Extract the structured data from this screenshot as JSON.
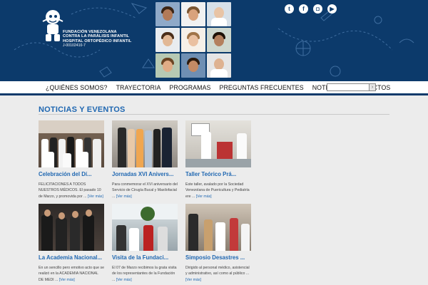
{
  "organization": {
    "lines": [
      "FUNDACIÓN VENEZOLANA",
      "CONTRA LA PARÁLISIS INFANTIL",
      "HOSPITAL ORTOPÉDICO INFANTIL"
    ],
    "rif": "J-00102410-7"
  },
  "social": [
    {
      "icon": "twitter-icon",
      "glyph": "t"
    },
    {
      "icon": "facebook-icon",
      "glyph": "f"
    },
    {
      "icon": "instagram-icon",
      "glyph": "◘"
    },
    {
      "icon": "youtube-icon",
      "glyph": "▶"
    }
  ],
  "nav": {
    "items": [
      "¿QUIÉNES SOMOS?",
      "TRAYECTORIA",
      "PROGRAMAS",
      "PREGUNTAS FRECUENTES",
      "NOTICIAS",
      "CONTACTOS"
    ],
    "search_placeholder": ""
  },
  "section": {
    "title": "NOTICIAS Y EVENTOS"
  },
  "news": [
    {
      "title": "Celebración del Dí...",
      "excerpt": "FELICITACIONES A TODOS NUESTROS MÉDICOS. El pasado 10 de Marzo, y promovida por ...",
      "more": "[Ver más]"
    },
    {
      "title": "Jornadas XVI Anivers...",
      "excerpt": "Para conmemorar el XVI aniversario del Servicio de Cirugía Bucal y Maxilofacial ...",
      "more": "[Ver más]"
    },
    {
      "title": "Taller Teórico Prá...",
      "excerpt": "Este taller, avalado por la Sociedad Venezolana de Puericultura y Pediatría ere ...",
      "more": "[Ver más]"
    },
    {
      "title": "La Academia Nacional...",
      "excerpt": "En un sencillo pero emotivo acto que se realizó en la ACADEMIA NACIONAL DE MEDI ...",
      "more": "[Ver más]"
    },
    {
      "title": "Visita de la Fundaci...",
      "excerpt": "El 07 de Marzo recibimos la grata visita de los representantes de la Fundación ...",
      "more": "[Ver más]"
    },
    {
      "title": "Simposio Desastres ...",
      "excerpt": "Dirigido al personal médico, asistencial y administrativo, así como al público ...",
      "more": "[Ver más]"
    }
  ]
}
